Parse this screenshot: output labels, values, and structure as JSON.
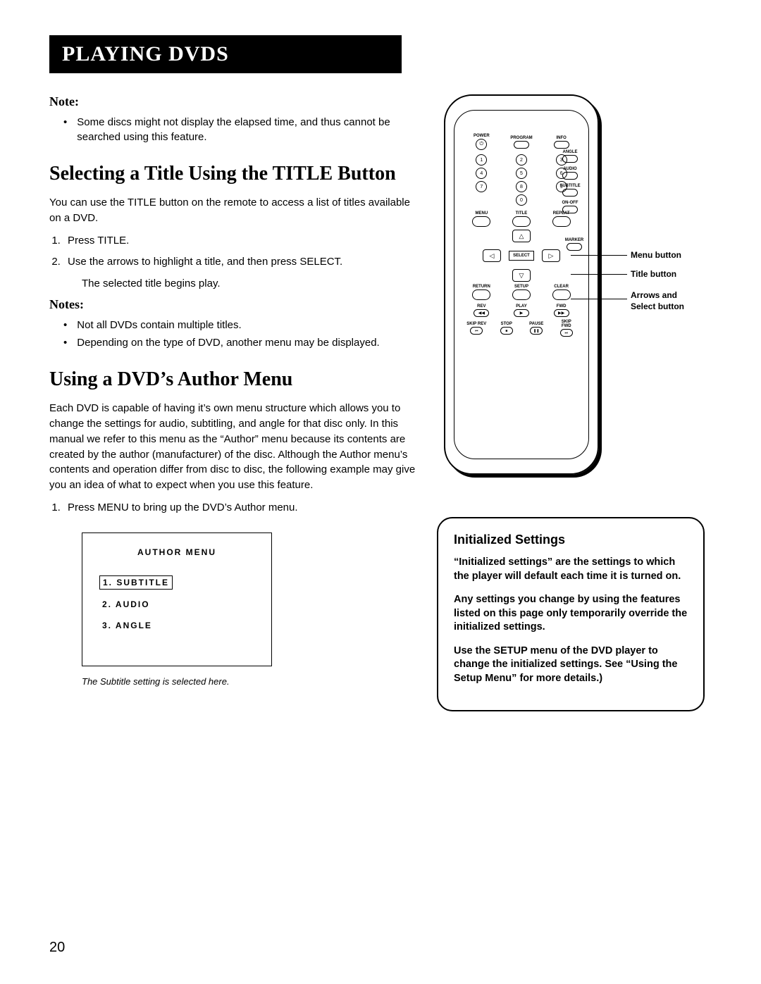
{
  "header": "PLAYING DVDS",
  "note1_h": "Note:",
  "note1_item": "Some discs might not display the elapsed time, and thus cannot be searched using this feature.",
  "section1_h": "Selecting a Title Using the TITLE Button",
  "section1_body": "You can use the TITLE button on the remote to access a list of titles available on a DVD.",
  "section1_steps": [
    "Press TITLE.",
    "Use the arrows to highlight a title, and then press SELECT."
  ],
  "section1_sub": "The selected title begins play.",
  "notes2_h": "Notes:",
  "notes2_items": [
    "Not all DVDs contain multiple titles.",
    "Depending on the type of DVD, another menu may be displayed."
  ],
  "section2_h": "Using a DVD’s Author Menu",
  "section2_body": "Each DVD is capable of having it’s own menu structure which allows you to change the settings for audio, subtitling, and angle for that disc only. In this manual we refer to this menu as the “Author” menu because its contents are created by the author (manufacturer) of the disc. Although the Author menu’s contents and operation differ from disc to disc, the following example may give you an idea of what to expect when you use this feature.",
  "section2_step1": "Press MENU to bring up the DVD’s Author menu.",
  "author_menu": {
    "title": "AUTHOR MENU",
    "items": [
      "1.  SUBTITLE",
      "2.  AUDIO",
      "3.  ANGLE"
    ],
    "selected_index": 0
  },
  "caption": "The Subtitle setting is selected here.",
  "page_num": "20",
  "callouts": {
    "menu": "Menu button",
    "title": "Title button",
    "arrows": "Arrows and Select button"
  },
  "info_box": {
    "heading": "Initialized Settings",
    "p1": "“Initialized settings” are the settings to which the player will default each time it is turned on.",
    "p2": "Any settings you change by using the features listed on this page only temporarily override the initialized settings.",
    "p3": "Use the SETUP menu of the DVD player to change the initialized settings. See “Using the Setup Menu” for more details.)"
  },
  "remote": {
    "power": "POWER",
    "program": "PROGRAM",
    "info": "INFO",
    "angle": "ANGLE",
    "audio": "AUDIO",
    "subtitle": "SUBTITLE",
    "onoff": "ON-OFF",
    "menu": "MENU",
    "title": "TITLE",
    "repeat": "REPEAT",
    "marker": "MARKER",
    "return": "RETURN",
    "setup": "SETUP",
    "clear": "CLEAR",
    "rev": "REV",
    "play": "PLAY",
    "fwd": "FWD",
    "skiprev": "SKIP REV",
    "stop": "STOP",
    "pause": "PAUSE",
    "skipfwd": "SKIP FWD",
    "select": "SELECT",
    "nums": [
      "1",
      "2",
      "3",
      "4",
      "5",
      "6",
      "7",
      "8",
      "9",
      "0"
    ]
  }
}
